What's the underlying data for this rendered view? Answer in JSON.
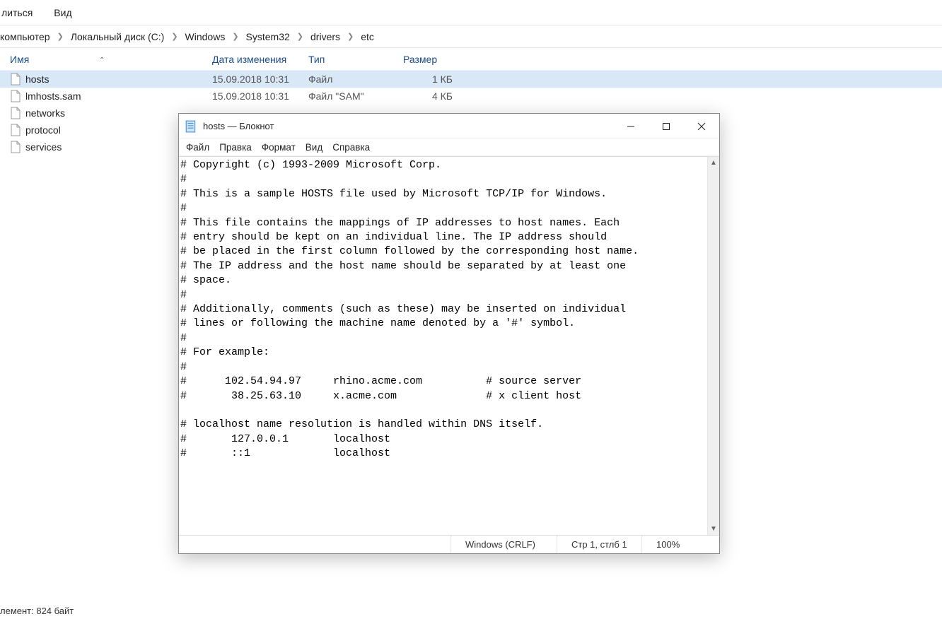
{
  "explorer": {
    "menu": [
      "литься",
      "Вид"
    ],
    "breadcrumbs": [
      "компьютер",
      "Локальный диск (C:)",
      "Windows",
      "System32",
      "drivers",
      "etc"
    ],
    "columns": {
      "name": "Имя",
      "date": "Дата изменения",
      "type": "Тип",
      "size": "Размер"
    },
    "files": [
      {
        "name": "hosts",
        "date": "15.09.2018 10:31",
        "type": "Файл",
        "size": "1 КБ",
        "selected": true
      },
      {
        "name": "lmhosts.sam",
        "date": "15.09.2018 10:31",
        "type": "Файл \"SAM\"",
        "size": "4 КБ",
        "selected": false
      },
      {
        "name": "networks",
        "date": "",
        "type": "",
        "size": "",
        "selected": false
      },
      {
        "name": "protocol",
        "date": "",
        "type": "",
        "size": "",
        "selected": false
      },
      {
        "name": "services",
        "date": "",
        "type": "",
        "size": "",
        "selected": false
      }
    ],
    "status": "лемент: 824 байт"
  },
  "notepad": {
    "title": "hosts — Блокнот",
    "menu": [
      "Файл",
      "Правка",
      "Формат",
      "Вид",
      "Справка"
    ],
    "content": "# Copyright (c) 1993-2009 Microsoft Corp.\n#\n# This is a sample HOSTS file used by Microsoft TCP/IP for Windows.\n#\n# This file contains the mappings of IP addresses to host names. Each\n# entry should be kept on an individual line. The IP address should\n# be placed in the first column followed by the corresponding host name.\n# The IP address and the host name should be separated by at least one\n# space.\n#\n# Additionally, comments (such as these) may be inserted on individual\n# lines or following the machine name denoted by a '#' symbol.\n#\n# For example:\n#\n#      102.54.94.97     rhino.acme.com          # source server\n#       38.25.63.10     x.acme.com              # x client host\n\n# localhost name resolution is handled within DNS itself.\n#\t127.0.0.1       localhost\n#\t::1             localhost",
    "status": {
      "encoding": "Windows (CRLF)",
      "pos": "Стр 1, стлб 1",
      "zoom": "100%"
    }
  }
}
